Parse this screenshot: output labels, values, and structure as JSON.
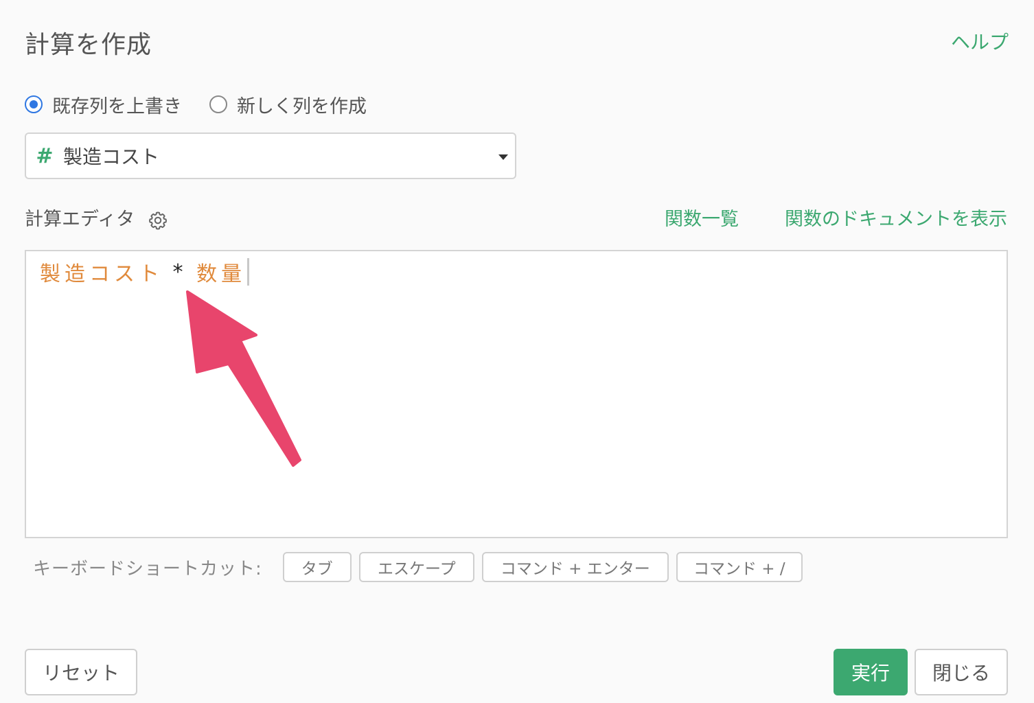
{
  "dialog": {
    "title": "計算を作成",
    "help_link": "ヘルプ"
  },
  "mode": {
    "options": [
      {
        "label": "既存列を上書き",
        "selected": true
      },
      {
        "label": "新しく列を作成",
        "selected": false
      }
    ]
  },
  "column_select": {
    "type_icon": "#",
    "value": "製造コスト"
  },
  "editor": {
    "label": "計算エディタ",
    "function_list_link": "関数一覧",
    "function_docs_link": "関数のドキュメントを表示",
    "expression": {
      "left_column": "製造コスト",
      "operator": "*",
      "right_column": "数量"
    }
  },
  "shortcuts": {
    "label": "キーボードショートカット:",
    "keys": [
      "タブ",
      "エスケープ",
      "コマンド + エンター",
      "コマンド + /"
    ]
  },
  "footer": {
    "reset_label": "リセット",
    "run_label": "実行",
    "close_label": "閉じる"
  },
  "colors": {
    "accent_green": "#3ca870",
    "radio_blue": "#2f77e2",
    "column_token_orange": "#e08a3c",
    "annotation_pink": "#e8456c"
  }
}
